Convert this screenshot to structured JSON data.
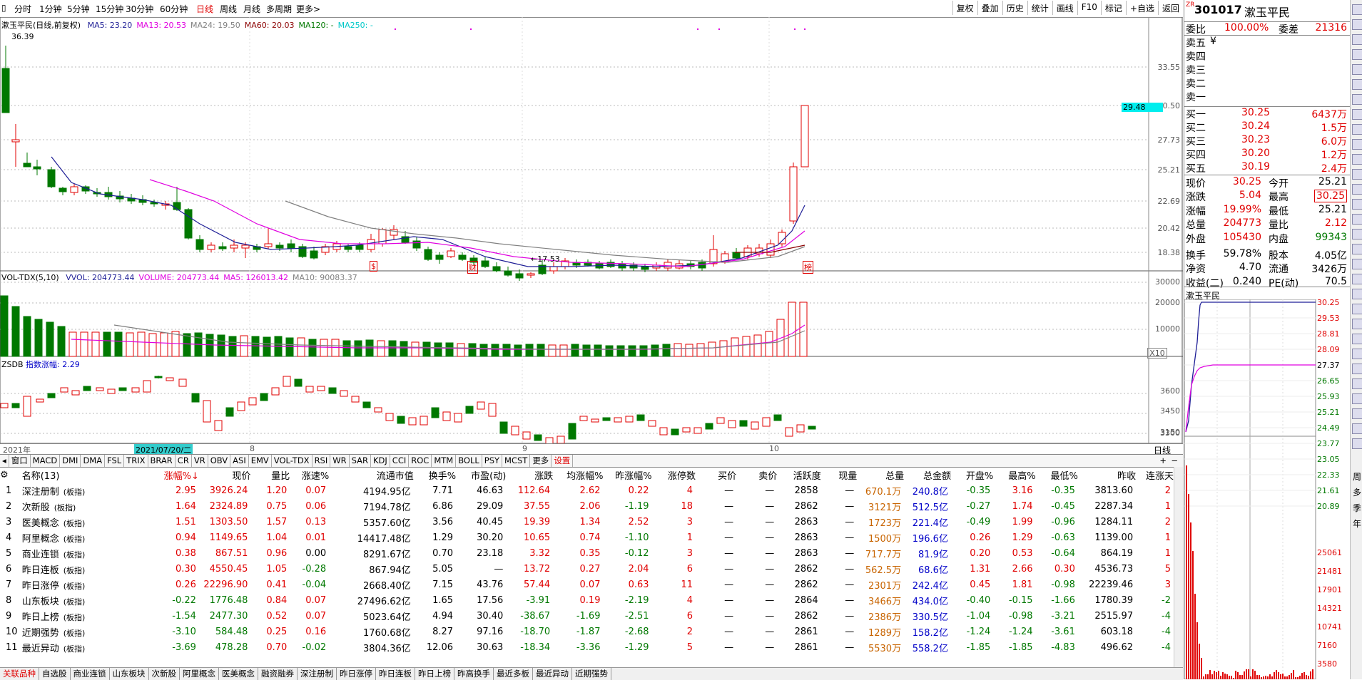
{
  "toolbar": {
    "periods": [
      "分时",
      "1分钟",
      "5分钟",
      "15分钟",
      "30分钟",
      "60分钟",
      "日线",
      "周线",
      "月线",
      "多周期",
      "更多>"
    ],
    "active_period": "日线",
    "right_buttons": [
      "复权",
      "叠加",
      "历史",
      "统计",
      "画线",
      "F10",
      "标记",
      "+自选",
      "返回"
    ]
  },
  "main_chart": {
    "title": "漱玉平民(日线,前复权)",
    "ma_legend": [
      {
        "text": "MA5: 23.20",
        "color": "#1e1e96"
      },
      {
        "text": "MA13: 20.53",
        "color": "#e000e0"
      },
      {
        "text": "MA24: 19.50",
        "color": "#808080"
      },
      {
        "text": "MA60: 20.03",
        "color": "#8b0000"
      },
      {
        "text": "MA120: -",
        "color": "#007800"
      },
      {
        "text": "MA250: -",
        "color": "#00c8c8"
      }
    ],
    "high_label": "36.39",
    "low_label": "17.53",
    "price_ticks": [
      "33.55",
      "30.50",
      "27.73",
      "25.21",
      "22.69",
      "20.42",
      "18.38"
    ],
    "current_price_tag": "29.48",
    "markers": [
      "$",
      "财",
      "榜"
    ]
  },
  "vol_panel": {
    "label": "VOL-TDX(5,10)",
    "legend": [
      {
        "text": "VVOL: 204773.44",
        "color": "#1e1e96"
      },
      {
        "text": "VOLUME: 204773.44",
        "color": "#e000e0"
      },
      {
        "text": "MA5: 126013.42",
        "color": "#e000e0"
      },
      {
        "text": "MA10: 90083.37",
        "color": "#808080"
      }
    ],
    "ticks": [
      "30000",
      "20000",
      "10000"
    ],
    "unit": "X10"
  },
  "zsdb_panel": {
    "label": "ZSDB",
    "legend": "指数涨幅: 2.29",
    "ticks": [
      "3600",
      "3450",
      "3300",
      "3150"
    ]
  },
  "time_axis": {
    "labels": [
      "2021年",
      "8",
      "9",
      "10"
    ],
    "cursor_date": "2021/07/20/二",
    "period_label": "日线"
  },
  "indicator_tabs": [
    "窗口",
    "MACD",
    "DMI",
    "DMA",
    "FSL",
    "TRIX",
    "BRAR",
    "CR",
    "VR",
    "OBV",
    "ASI",
    "EMV",
    "VOL-TDX",
    "RSI",
    "WR",
    "SAR",
    "KDJ",
    "CCI",
    "ROC",
    "MTM",
    "BOLL",
    "PSY",
    "MCST",
    "更多",
    "设置"
  ],
  "table": {
    "headers": [
      "名称(13)",
      "",
      "涨幅%↓",
      "现价",
      "量比",
      "涨速%",
      "流通市值",
      "换手%",
      "市盈(动)",
      "涨跌",
      "均涨幅%",
      "昨涨幅%",
      "涨停数",
      "买价",
      "卖价",
      "活跃度",
      "现量",
      "总量",
      "总金额",
      "开盘%",
      "最高%",
      "最低%",
      "昨收",
      "连涨天"
    ],
    "rows": [
      [
        "1",
        "深注册制",
        "(板指)",
        "2.95",
        "3926.24",
        "1.20",
        "0.07",
        "4194.95亿",
        "7.71",
        "46.63",
        "112.64",
        "2.62",
        "0.22",
        "4",
        "—",
        "—",
        "2858",
        "—",
        "670.1万",
        "240.8亿",
        "-0.35",
        "3.16",
        "-0.35",
        "3813.60",
        "2"
      ],
      [
        "2",
        "次新股",
        "(板指)",
        "1.64",
        "2324.89",
        "0.75",
        "0.06",
        "7194.78亿",
        "6.86",
        "29.09",
        "37.55",
        "2.06",
        "-1.19",
        "18",
        "—",
        "—",
        "2862",
        "—",
        "3121万",
        "512.5亿",
        "-0.27",
        "1.74",
        "-0.45",
        "2287.34",
        "1"
      ],
      [
        "3",
        "医美概念",
        "(板指)",
        "1.51",
        "1303.50",
        "1.57",
        "0.13",
        "5357.60亿",
        "3.56",
        "40.45",
        "19.39",
        "1.34",
        "2.52",
        "3",
        "—",
        "—",
        "2863",
        "—",
        "1723万",
        "221.4亿",
        "-0.49",
        "1.99",
        "-0.96",
        "1284.11",
        "2"
      ],
      [
        "4",
        "阿里概念",
        "(板指)",
        "0.94",
        "1149.65",
        "1.04",
        "0.01",
        "14417.48亿",
        "1.29",
        "30.20",
        "10.65",
        "0.74",
        "-1.10",
        "1",
        "—",
        "—",
        "2863",
        "—",
        "1500万",
        "196.6亿",
        "0.26",
        "1.29",
        "-0.63",
        "1139.00",
        "1"
      ],
      [
        "5",
        "商业连锁",
        "(板指)",
        "0.38",
        "867.51",
        "0.96",
        "0.00",
        "8291.67亿",
        "0.70",
        "23.18",
        "3.32",
        "0.35",
        "-0.12",
        "3",
        "—",
        "—",
        "2863",
        "—",
        "717.7万",
        "81.9亿",
        "0.20",
        "0.53",
        "-0.64",
        "864.19",
        "1"
      ],
      [
        "6",
        "昨日连板",
        "(板指)",
        "0.30",
        "4550.45",
        "1.05",
        "-0.28",
        "867.94亿",
        "5.05",
        "—",
        "13.72",
        "0.27",
        "2.04",
        "6",
        "—",
        "—",
        "2862",
        "—",
        "562.5万",
        "68.6亿",
        "1.31",
        "2.66",
        "0.30",
        "4536.73",
        "5"
      ],
      [
        "7",
        "昨日涨停",
        "(板指)",
        "0.26",
        "22296.90",
        "0.41",
        "-0.04",
        "2668.40亿",
        "7.15",
        "43.76",
        "57.44",
        "0.07",
        "0.63",
        "11",
        "—",
        "—",
        "2862",
        "—",
        "2301万",
        "242.4亿",
        "0.45",
        "1.81",
        "-0.98",
        "22239.46",
        "3"
      ],
      [
        "8",
        "山东板块",
        "(板指)",
        "-0.22",
        "1776.48",
        "0.84",
        "0.07",
        "27496.62亿",
        "1.65",
        "17.56",
        "-3.91",
        "0.19",
        "-2.19",
        "4",
        "—",
        "—",
        "2864",
        "—",
        "3466万",
        "434.0亿",
        "-0.40",
        "-0.15",
        "-1.66",
        "1780.39",
        "-2"
      ],
      [
        "9",
        "昨日上榜",
        "(板指)",
        "-1.54",
        "2477.30",
        "0.52",
        "0.07",
        "5023.64亿",
        "4.94",
        "30.40",
        "-38.67",
        "-1.69",
        "-2.51",
        "6",
        "—",
        "—",
        "2862",
        "—",
        "2386万",
        "330.5亿",
        "-1.04",
        "-0.98",
        "-3.21",
        "2515.97",
        "-4"
      ],
      [
        "10",
        "近期强势",
        "(板指)",
        "-3.10",
        "584.48",
        "0.25",
        "0.16",
        "1760.68亿",
        "8.27",
        "97.16",
        "-18.70",
        "-1.87",
        "-2.68",
        "2",
        "—",
        "—",
        "2861",
        "—",
        "1289万",
        "158.2亿",
        "-1.24",
        "-1.24",
        "-3.61",
        "603.18",
        "-4"
      ],
      [
        "11",
        "最近异动",
        "(板指)",
        "-3.69",
        "478.28",
        "0.70",
        "-0.02",
        "3804.36亿",
        "12.06",
        "30.63",
        "-18.34",
        "-3.36",
        "-1.29",
        "5",
        "—",
        "—",
        "2861",
        "—",
        "5530万",
        "558.2亿",
        "-1.85",
        "-1.85",
        "-4.83",
        "496.62",
        "-4"
      ]
    ]
  },
  "bottom_tabs": [
    "关联品种",
    "自选股",
    "商业连锁",
    "山东板块",
    "次新股",
    "阿里概念",
    "医美概念",
    "融资融券",
    "深注册制",
    "昨日涨停",
    "昨日连板",
    "昨日上榜",
    "昨高换手",
    "最近多板",
    "最近异动",
    "近期强势"
  ],
  "quote": {
    "code": "301017",
    "name": "漱玉平民",
    "weibi_label": "委比",
    "weibi": "100.00%",
    "weicha_label": "委差",
    "weicha": "21316",
    "asks": [
      {
        "label": "卖五",
        "price": "¥",
        "vol": ""
      },
      {
        "label": "卖四",
        "price": "",
        "vol": ""
      },
      {
        "label": "卖三",
        "price": "",
        "vol": ""
      },
      {
        "label": "卖二",
        "price": "",
        "vol": ""
      },
      {
        "label": "卖一",
        "price": "",
        "vol": ""
      }
    ],
    "bids": [
      {
        "label": "买一",
        "price": "30.25",
        "vol": "6437万"
      },
      {
        "label": "买二",
        "price": "30.24",
        "vol": "1.5万"
      },
      {
        "label": "买三",
        "price": "30.23",
        "vol": "6.0万"
      },
      {
        "label": "买四",
        "price": "30.20",
        "vol": "1.2万"
      },
      {
        "label": "买五",
        "price": "30.19",
        "vol": "2.4万"
      }
    ],
    "stats": [
      [
        "现价",
        "30.25",
        "今开",
        "25.21"
      ],
      [
        "涨跌",
        "5.04",
        "最高",
        "30.25"
      ],
      [
        "涨幅",
        "19.99%",
        "最低",
        "25.21"
      ],
      [
        "总量",
        "204773",
        "量比",
        "2.12"
      ],
      [
        "外盘",
        "105430",
        "内盘",
        "99343"
      ],
      [
        "换手",
        "59.78%",
        "股本",
        "4.05亿"
      ],
      [
        "净资",
        "4.70",
        "流通",
        "3426万"
      ],
      [
        "收益(二)",
        "0.240",
        "PE(动)",
        "70.5"
      ]
    ],
    "mini_title": "漱玉平民",
    "mini_ticks": [
      "30.25",
      "29.53",
      "28.81",
      "28.09",
      "27.37",
      "26.65",
      "25.93",
      "25.21",
      "24.49",
      "23.77",
      "23.05",
      "22.33",
      "21.61",
      "20.89"
    ],
    "mini_vol_ticks": [
      "25061",
      "21481",
      "17901",
      "14321",
      "10741",
      "7160",
      "3580"
    ]
  },
  "side_toolbar": [
    "ZR",
    "周",
    "多",
    "季",
    "年"
  ]
}
